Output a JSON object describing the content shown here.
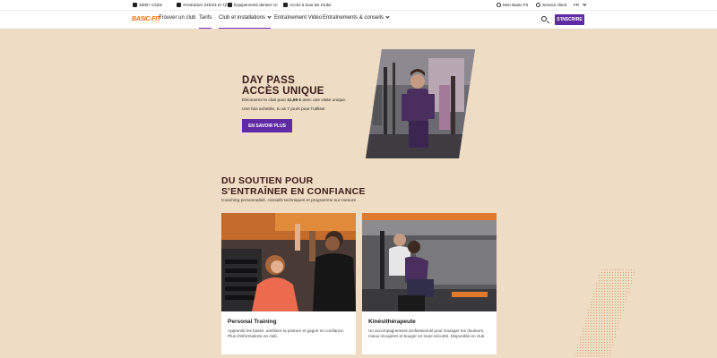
{
  "topbar": {
    "items": [
      {
        "icon": "club-icon",
        "label": "1800+ Clubs"
      },
      {
        "icon": "clock-icon",
        "label": "S'entraîner 24h/24 et 7j/7"
      },
      {
        "icon": "equipment-icon",
        "label": "Équipements dernier cri"
      },
      {
        "icon": "access-icon",
        "label": "Accès à tous les Clubs"
      }
    ],
    "account": "Mon Basic-Fit",
    "service": "Service client",
    "language": "FR"
  },
  "nav": {
    "logo": "BASIC-FIT",
    "links": [
      "Trouver un club",
      "Tarifs",
      "Club et installations",
      "Entraînement Vidéo",
      "Entraînements & conseils"
    ],
    "cta": "S'INSCRIRE"
  },
  "hero": {
    "title_line1": "DAY PASS",
    "title_line2": "ACCÈS UNIQUE",
    "desc_prefix": "Découvrez le club pour ",
    "desc_price": "11,99 €",
    "desc_suffix": " avec une visite unique.",
    "desc2": "Une fois achetée, tu as 7 jours pour l'utiliser",
    "button": "EN SAVOIR PLUS"
  },
  "section": {
    "title_line1": "DU SOUTIEN POUR",
    "title_line2": "S'ENTRAÎNER EN CONFIANCE",
    "subtitle": "Coaching personnalisé, conseils techniques et programme sur-mesure",
    "cards": [
      {
        "title": "Personal Training",
        "desc": "Apprends les bases, améliore ta posture et gagne en confiance. Plus d'informations en club."
      },
      {
        "title": "Kinésithérapeute",
        "desc": "Un accompagnement professionnel pour soulager tes douleurs, mieux récupérer et bouger en toute sécurité. Disponible en club"
      }
    ]
  },
  "colors": {
    "brand_orange": "#ff6a00",
    "purple": "#5e2aa6",
    "background": "#efdcc4"
  }
}
